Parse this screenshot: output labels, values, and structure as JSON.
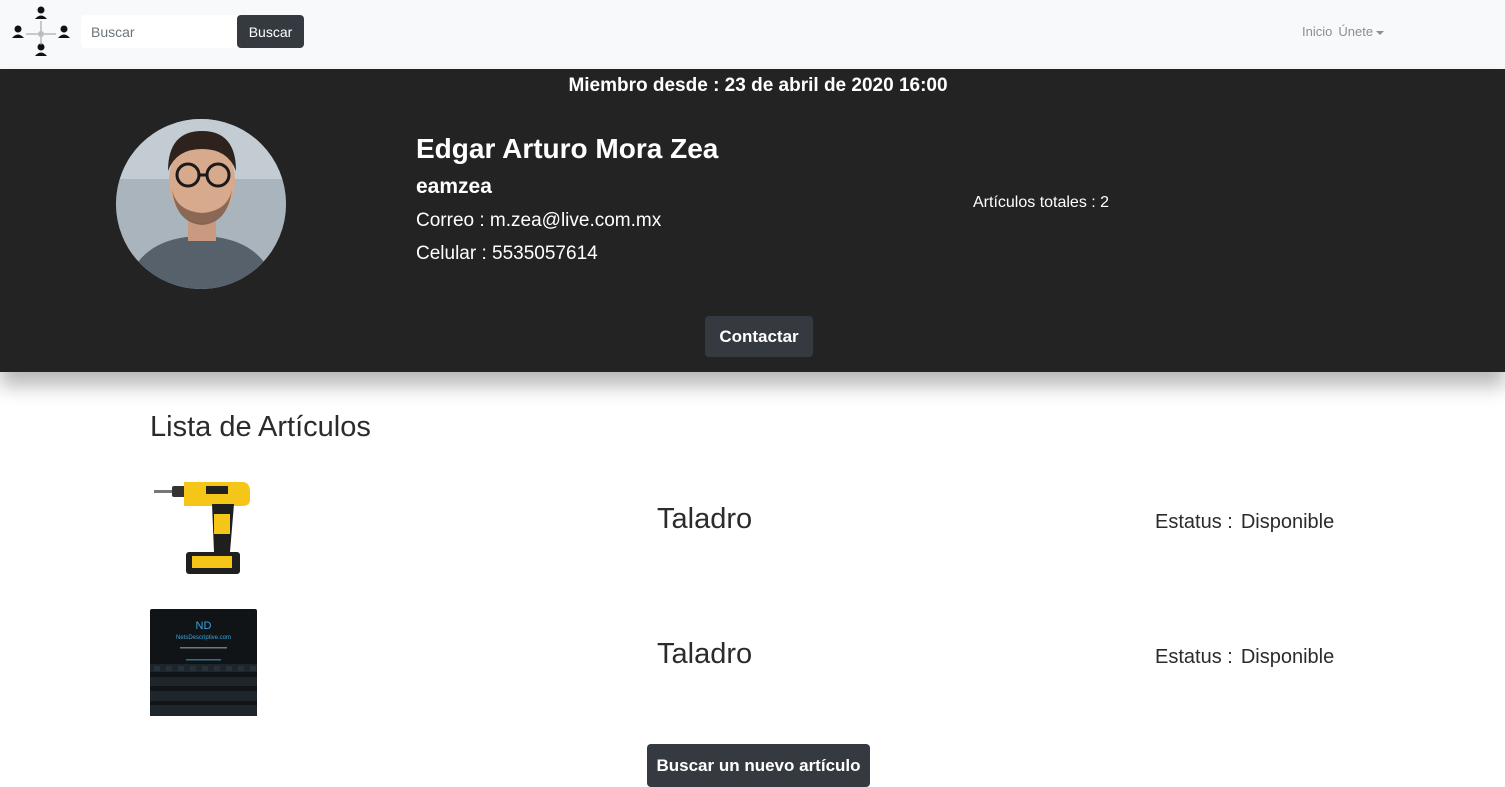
{
  "navbar": {
    "logo_icon": "people-network-icon",
    "search_placeholder": "Buscar",
    "search_button": "Buscar",
    "link_home": "Inicio",
    "link_join": "Únete"
  },
  "profile": {
    "member_since": "Miembro desde : 23 de abril de 2020 16:00",
    "full_name": "Edgar Arturo Mora Zea",
    "username": "eamzea",
    "email_line": "Correo : m.zea@live.com.mx",
    "phone_line": "Celular : 5535057614",
    "total_articles": "Artículos totales : 2",
    "contact_button": "Contactar"
  },
  "articles": {
    "title": "Lista de Artículos",
    "items": [
      {
        "name": "Taladro",
        "status_label": "Estatus :",
        "status_value": "Disponible",
        "image_icon": "drill-icon"
      },
      {
        "name": "Taladro",
        "status_label": "Estatus :",
        "status_value": "Disponible",
        "image_icon": "theater-seats-image",
        "image_text_1": "ND",
        "image_text_2": "NetsDescriptive.com"
      }
    ],
    "new_button": "Buscar un nuevo artículo"
  },
  "colors": {
    "navbar_bg": "#f8f9fa",
    "banner_bg": "#232323",
    "button_dark": "#343a40",
    "drill_yellow": "#f5c518"
  }
}
